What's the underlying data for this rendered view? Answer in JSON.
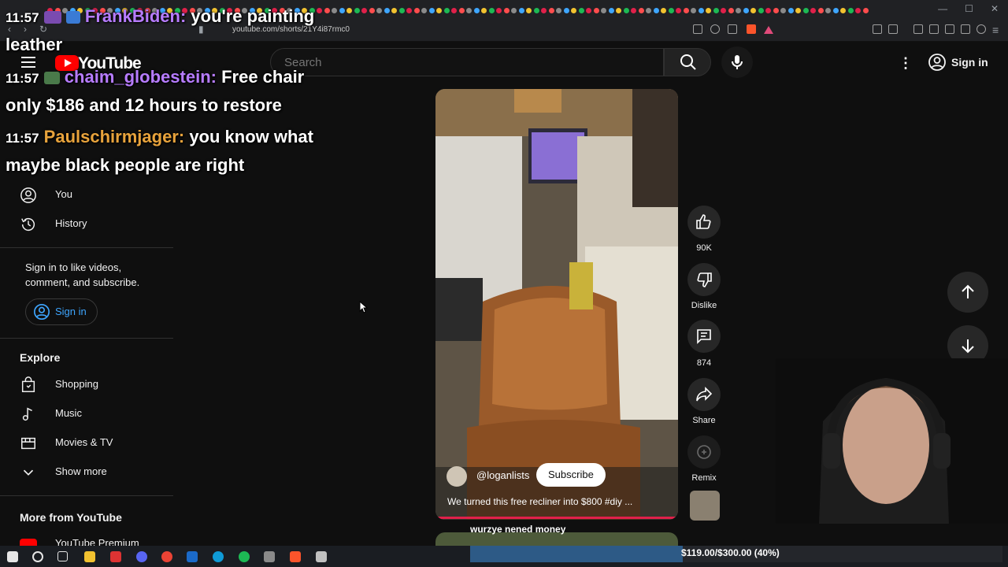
{
  "browser": {
    "url": "youtube.com/shorts/21Y4i87rmc0"
  },
  "youtube": {
    "logo_text": "YouTube",
    "search_placeholder": "Search",
    "sign_in": "Sign in"
  },
  "sidebar": {
    "items_top": [
      {
        "label": "You",
        "icon": "person-circle-icon"
      },
      {
        "label": "History",
        "icon": "history-icon"
      }
    ],
    "signin_prompt": "Sign in to like videos, comment, and subscribe.",
    "signin_button": "Sign in",
    "explore_title": "Explore",
    "explore_items": [
      {
        "label": "Shopping",
        "icon": "shopping-bag-icon"
      },
      {
        "label": "Music",
        "icon": "music-note-icon"
      },
      {
        "label": "Movies & TV",
        "icon": "film-icon"
      },
      {
        "label": "Show more",
        "icon": "chevron-down-icon"
      }
    ],
    "more_title": "More from YouTube",
    "more_items": [
      {
        "label": "YouTube Premium"
      }
    ]
  },
  "chat": [
    {
      "time": "11:57",
      "user": "FrankBiden:",
      "user_color": "#b77cff",
      "message": "you're painting leather"
    },
    {
      "time": "11:57",
      "user": "chaim_globestein:",
      "user_color": "#b77cff",
      "message": "Free chair only $186 and 12 hours to restore"
    },
    {
      "time": "11:57",
      "user": "Paulschirmjager:",
      "user_color": "#e8a33c",
      "message": "you know what maybe black people are right"
    }
  ],
  "short": {
    "channel": "@loganlists",
    "subscribe": "Subscribe",
    "title": "We turned this free recliner into $800 #diy ...",
    "next_title": "wurzye nened money",
    "actions": [
      {
        "label": "90K",
        "icon": "thumbs-up-icon"
      },
      {
        "label": "Dislike",
        "icon": "thumbs-down-icon"
      },
      {
        "label": "874",
        "icon": "comment-icon"
      },
      {
        "label": "Share",
        "icon": "share-icon"
      },
      {
        "label": "Remix",
        "icon": "remix-icon"
      }
    ]
  },
  "donation_goal": {
    "text": "$119.00/$300.00 (40%)",
    "fraction": 0.4
  },
  "colors": {
    "accent_red": "#ff0000",
    "link_blue": "#3ea6ff",
    "goal_fill": "#2d5a86"
  }
}
